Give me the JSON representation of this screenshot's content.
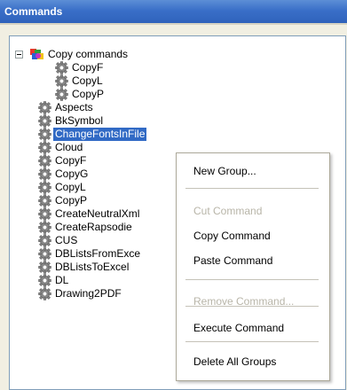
{
  "window": {
    "title": "Commands"
  },
  "tree": {
    "group": {
      "label": "Copy commands",
      "expanded": true
    },
    "group_children": [
      "CopyF",
      "CopyL",
      "CopyP"
    ],
    "items": [
      "Aspects",
      "BkSymbol",
      "ChangeFontsInFile",
      "Cloud",
      "CopyF",
      "CopyG",
      "CopyL",
      "CopyP",
      "CreateNeutralXml",
      "CreateRapsodie",
      "CUS",
      "DBListsFromExce",
      "DBListsToExcel",
      "DL",
      "Drawing2PDF"
    ],
    "selected": "ChangeFontsInFile"
  },
  "context_menu": {
    "items": [
      {
        "label": "New Group...",
        "enabled": true
      },
      {
        "label": "Cut Command",
        "enabled": false
      },
      {
        "label": "Copy Command",
        "enabled": true
      },
      {
        "label": "Paste Command",
        "enabled": true
      },
      {
        "label": "Remove Command...",
        "enabled": false
      },
      {
        "label": "Execute Command",
        "enabled": true
      },
      {
        "label": "Delete All Groups",
        "enabled": true
      }
    ]
  },
  "colors": {
    "title_bar": "#3a6fc8",
    "selection": "#316ac5",
    "disabled_text": "#b8b5a8"
  },
  "icons": {
    "group": "colorful-group-icon",
    "command": "gear-icon"
  }
}
